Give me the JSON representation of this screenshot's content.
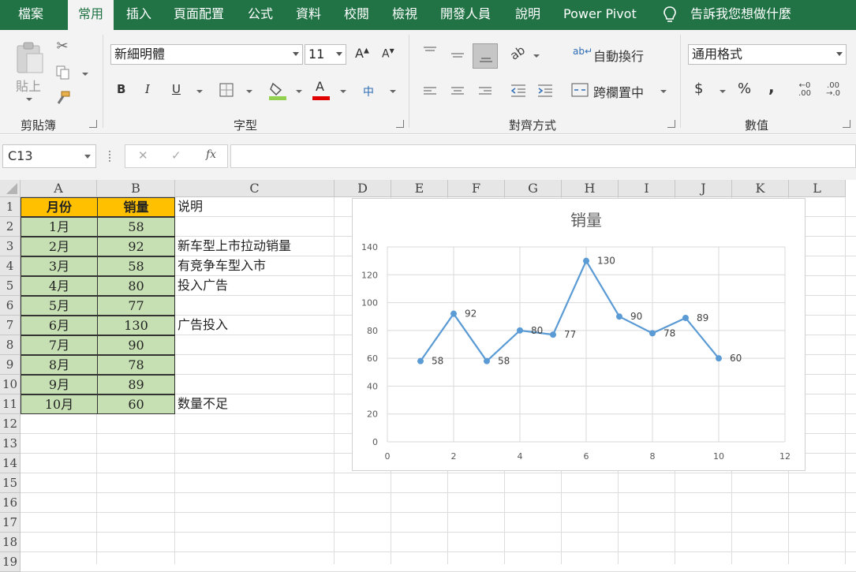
{
  "menu": {
    "tabs": [
      "檔案",
      "常用",
      "插入",
      "頁面配置",
      "公式",
      "資料",
      "校閱",
      "檢視",
      "開發人員",
      "說明",
      "Power Pivot"
    ],
    "active": "常用",
    "tell_me": "告訴我您想做什麼"
  },
  "ribbon": {
    "clipboard": {
      "paste_label": "貼上",
      "group_label": "剪貼簿"
    },
    "font": {
      "font_name": "新細明體",
      "font_size": "11",
      "group_label": "字型",
      "bold": "B",
      "italic": "I",
      "underline": "U",
      "grow": "A",
      "shrink": "A",
      "phonetic": "中"
    },
    "alignment": {
      "wrap_text": "自動換行",
      "merge_center": "跨欄置中",
      "group_label": "對齊方式"
    },
    "number": {
      "format": "通用格式",
      "currency": "$",
      "percent": "%",
      "comma": ",",
      "group_label": "數值"
    }
  },
  "formula_bar": {
    "name_box": "C13",
    "cancel": "✕",
    "enter": "✓",
    "fx": "fx",
    "value": ""
  },
  "columns": [
    "A",
    "B",
    "C",
    "D",
    "E",
    "F",
    "G",
    "H",
    "I",
    "J",
    "K",
    "L"
  ],
  "rows": [
    "1",
    "2",
    "3",
    "4",
    "5",
    "6",
    "7",
    "8",
    "9",
    "10",
    "11",
    "12",
    "13",
    "14",
    "15",
    "16",
    "17",
    "18",
    "19"
  ],
  "sheet": {
    "header": {
      "month": "月份",
      "sales": "销量",
      "note": "说明"
    },
    "data": [
      {
        "month": "1月",
        "sales": "58",
        "note": ""
      },
      {
        "month": "2月",
        "sales": "92",
        "note": "新车型上市拉动销量"
      },
      {
        "month": "3月",
        "sales": "58",
        "note": "有竞争车型入市"
      },
      {
        "month": "4月",
        "sales": "80",
        "note": "投入广告"
      },
      {
        "month": "5月",
        "sales": "77",
        "note": ""
      },
      {
        "month": "6月",
        "sales": "130",
        "note": "广告投入"
      },
      {
        "month": "7月",
        "sales": "90",
        "note": ""
      },
      {
        "month": "8月",
        "sales": "78",
        "note": ""
      },
      {
        "month": "9月",
        "sales": "89",
        "note": ""
      },
      {
        "month": "10月",
        "sales": "60",
        "note": "数量不足"
      }
    ]
  },
  "chart_data": {
    "type": "scatter",
    "title": "销量",
    "xlabel": "",
    "ylabel": "",
    "x": [
      1,
      2,
      3,
      4,
      5,
      6,
      7,
      8,
      9,
      10
    ],
    "y": [
      58,
      92,
      58,
      80,
      77,
      130,
      90,
      78,
      89,
      60
    ],
    "xlim": [
      0,
      12
    ],
    "ylim": [
      0,
      140
    ],
    "xticks": [
      0,
      2,
      4,
      6,
      8,
      10,
      12
    ],
    "yticks": [
      0,
      20,
      40,
      60,
      80,
      100,
      120,
      140
    ],
    "grid": true,
    "legend": "none",
    "lines": "straight",
    "data_labels": true,
    "series_color": "#5b9bd5"
  },
  "colors": {
    "excel_green": "#217346",
    "header_fill": "#ffc000",
    "data_fill": "#c6e0b4"
  }
}
